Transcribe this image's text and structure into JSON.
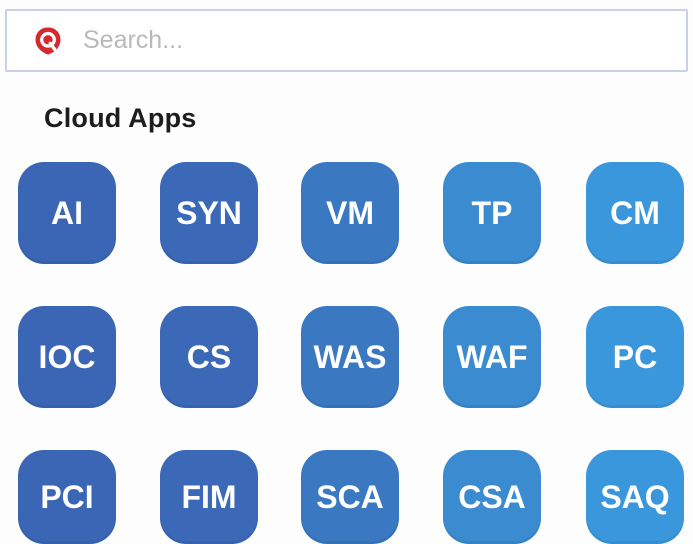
{
  "search": {
    "placeholder": "Search..."
  },
  "logo": {
    "icon": "qualys-logo-icon",
    "color": "#d42a2f"
  },
  "section": {
    "title": "Cloud Apps"
  },
  "apps": [
    {
      "label": "AI",
      "color": "#3a66b5"
    },
    {
      "label": "SYN",
      "color": "#3b69b8"
    },
    {
      "label": "VM",
      "color": "#3a79c2"
    },
    {
      "label": "TP",
      "color": "#3b8bd0"
    },
    {
      "label": "CM",
      "color": "#3b97dc"
    },
    {
      "label": "IOC",
      "color": "#3a66b5"
    },
    {
      "label": "CS",
      "color": "#3b69b8"
    },
    {
      "label": "WAS",
      "color": "#3a79c2"
    },
    {
      "label": "WAF",
      "color": "#3b8bd0"
    },
    {
      "label": "PC",
      "color": "#3b97dc"
    },
    {
      "label": "PCI",
      "color": "#3a66b5"
    },
    {
      "label": "FIM",
      "color": "#3b69b8"
    },
    {
      "label": "SCA",
      "color": "#3a79c2"
    },
    {
      "label": "CSA",
      "color": "#3b8bd0"
    },
    {
      "label": "SAQ",
      "color": "#3b97dc"
    }
  ]
}
